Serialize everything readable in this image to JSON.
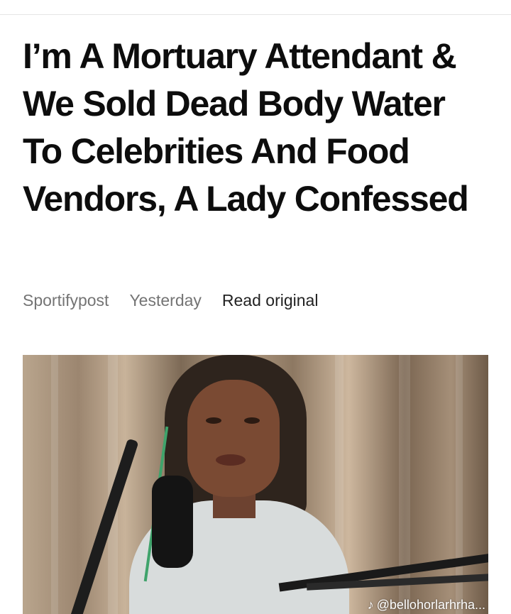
{
  "article": {
    "title": "I’m A Mortuary Attendant & We Sold Dead Body Water To Celebrities And Food Vendors, A Lady Confessed",
    "source": "Sportifypost",
    "date": "Yesterday",
    "read_original_label": "Read original"
  },
  "hero_image": {
    "description_icon": "photo",
    "watermark_icon": "tiktok-icon",
    "watermark_handle": "@bellohorlarhrha..."
  },
  "colors": {
    "background": "#ffffff",
    "title": "#0d0d0d",
    "meta": "#747474",
    "link": "#222222"
  }
}
